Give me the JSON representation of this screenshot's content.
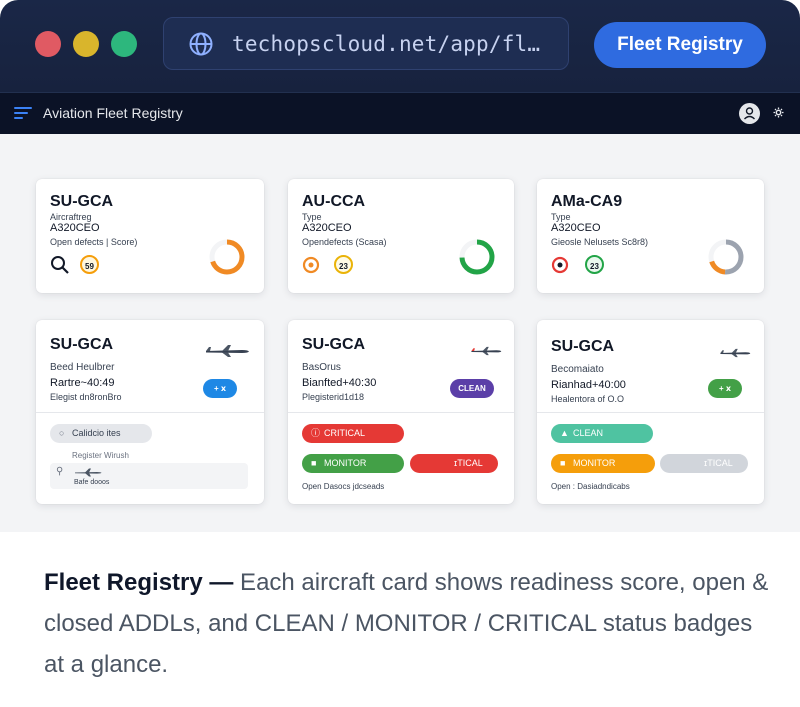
{
  "browser": {
    "url": "techopscloud.net/app/fl…",
    "brand_button": "Fleet Registry"
  },
  "app": {
    "title": "Aviation Fleet Registry"
  },
  "top_cards": [
    {
      "registration": "SU-GCA",
      "type_label": "Aircraftreg",
      "type": "A320CEO",
      "meta": "Open defects | Score)",
      "chip_value": "59",
      "score_color": "#f08a24",
      "chip_color": "#f59e0b"
    },
    {
      "registration": "AU-CCA",
      "type_label": "Type",
      "type": "A320CEO",
      "meta": "Opendefects (Scasa)",
      "chip_value": "23",
      "score_color": "#22a447",
      "chip_color": "#eab308"
    },
    {
      "registration": "AMa-CA9",
      "type_label": "Type",
      "type": "A320CEO",
      "meta": "Gieosle Nelusets Sc8r8)",
      "chip_value": "23",
      "score_color": "#9ca3af",
      "chip_color": "#22a447"
    }
  ],
  "lower_cards": [
    {
      "registration": "SU-GCA",
      "line1": "Beed Heulbrer",
      "line2": "Rartre~40:49",
      "line3": "Elegist dn8ronBro",
      "badge_label": "+ ⅹ",
      "badge_color": "#1e88e5",
      "pills": [
        {
          "label": "Calidcio ites",
          "color": "#e5e7eb",
          "text_color": "#374151"
        }
      ],
      "sub1": "Register Wirush",
      "sub2": "Bafe dooos"
    },
    {
      "registration": "SU-GCA",
      "line1": "BasOrus",
      "line2": "Bianfted+40:30",
      "line3": "Plegisterid1d18",
      "badge_label": "CLEAN",
      "badge_color": "#5b3fa8",
      "pills": [
        {
          "label": "CRITICAL",
          "color": "#e53935",
          "text_color": "#ffffff"
        },
        {
          "label": "MONITOR",
          "color": "#43a047",
          "text_color": "#ffffff"
        },
        {
          "label": "ɪTICAL",
          "color": "#e53935",
          "text_color": "#ffffff"
        }
      ],
      "sub1": "Open Dasocs jdcseads"
    },
    {
      "registration": "SU-GCA",
      "line1": "Becomaiato",
      "line2": "Rianhad+40:00",
      "line3": "Healentora of O.O",
      "badge_label": "+ ⅹ",
      "badge_color": "#43a047",
      "pills": [
        {
          "label": "CLEAN",
          "color": "#4fc3a1",
          "text_color": "#ffffff"
        },
        {
          "label": "MONITOR",
          "color": "#f59e0b",
          "text_color": "#ffffff"
        },
        {
          "label": "ɪTICAL",
          "color": "#d1d5db",
          "text_color": "#ffffff"
        }
      ],
      "sub1": "Open : Dasiadndicabs"
    }
  ],
  "caption": {
    "bold": "Fleet Registry —",
    "text": " Each aircraft card shows readiness score, open & closed ADDLs, and CLEAN / MONITOR / CRITICAL status badges at a glance."
  }
}
